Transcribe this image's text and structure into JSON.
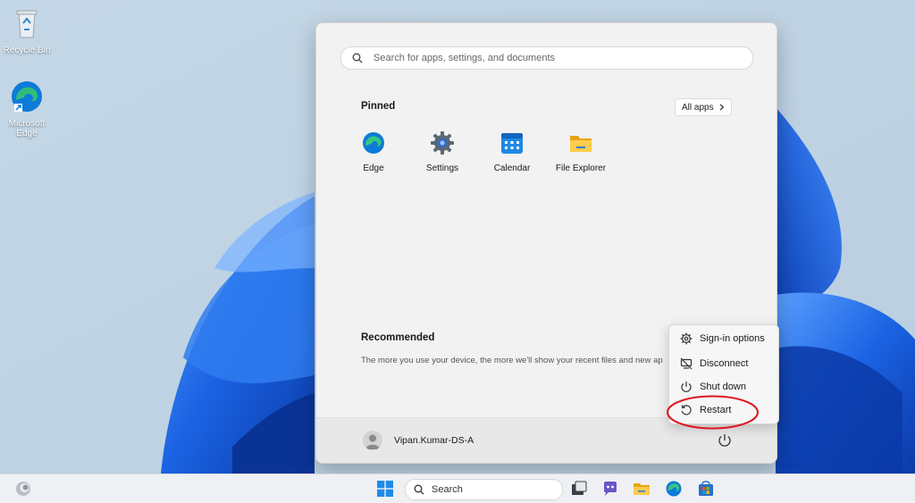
{
  "desktop": {
    "icons": [
      {
        "label": "Recycle Bin"
      },
      {
        "label": "Microsoft Edge"
      }
    ]
  },
  "start_menu": {
    "search_placeholder": "Search for apps, settings, and documents",
    "pinned_title": "Pinned",
    "all_apps_label": "All apps",
    "pinned_apps": [
      {
        "label": "Edge",
        "icon": "edge-icon"
      },
      {
        "label": "Settings",
        "icon": "gear-icon"
      },
      {
        "label": "Calendar",
        "icon": "calendar-icon"
      },
      {
        "label": "File Explorer",
        "icon": "folder-icon"
      }
    ],
    "recommended_title": "Recommended",
    "recommended_text": "The more you use your device, the more we'll show your recent files and new ap",
    "user_name": "Vipan.Kumar-DS-A"
  },
  "power_menu": {
    "items": [
      {
        "label": "Sign-in options",
        "icon": "gear-icon"
      },
      {
        "label": "Disconnect",
        "icon": "disconnect-icon"
      },
      {
        "label": "Shut down",
        "icon": "power-icon"
      },
      {
        "label": "Restart",
        "icon": "restart-icon"
      }
    ],
    "highlight_color": "#e0141e"
  },
  "taskbar": {
    "search_label": "Search"
  },
  "colors": {
    "accent": "#0067c0",
    "wallpaper_blue": "#1a5fd6"
  }
}
